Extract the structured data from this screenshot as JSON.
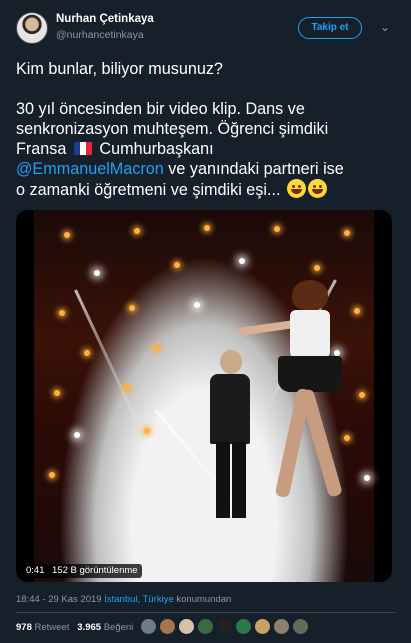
{
  "author": {
    "name": "Nurhan Çetinkaya",
    "handle": "@nurhancetinkaya"
  },
  "follow_label": "Takip et",
  "menu_icon": "chevron-down-icon",
  "tweet": {
    "line1": "Kim bunlar, biliyor musunuz?",
    "line2a": "30 yıl öncesinden bir video klip. Dans ve",
    "line2b": "senkronizasyon muhteşem. Öğrenci şimdiki",
    "line2c": "Fransa",
    "line2c_after": "Cumhurbaşkanı",
    "mention": "@EmmanuelMacron",
    "after_mention": " ve yanındaki partneri  ise",
    "line_last": "o zamanki öğretmeni ve şimdiki eşi... "
  },
  "video": {
    "duration": "0:41",
    "views": "152 B görüntülenme"
  },
  "meta": {
    "time": "18:44 - 29 Kas 2019",
    "location": "İstanbul, Türkiye",
    "location_suffix": " konumundan"
  },
  "stats": {
    "retweets_count": "978",
    "retweets_label": "Retweet",
    "likes_count": "3.965",
    "likes_label": "Beğeni"
  },
  "colors": {
    "background": "#15202b",
    "accent": "#1da1f2",
    "secondary_text": "#8899a6"
  }
}
